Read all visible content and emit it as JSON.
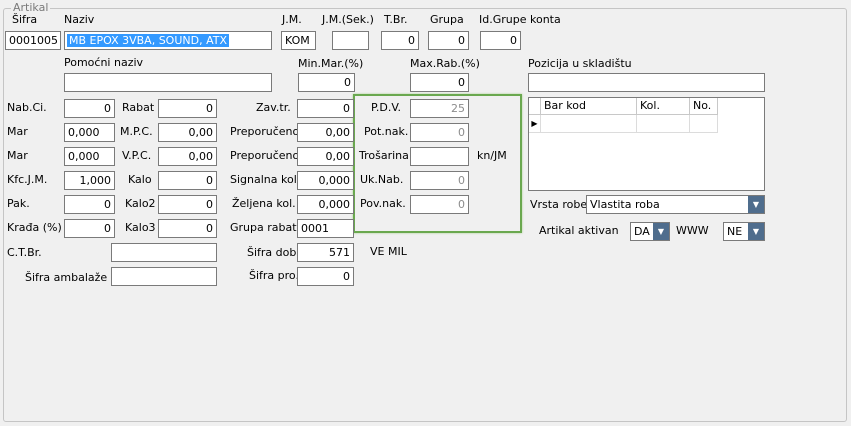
{
  "group_title": "Artikal",
  "labels": {
    "sifra": "Šifra",
    "naziv": "Naziv",
    "jm": "J.M.",
    "jm_sek": "J.M.(Sek.)",
    "tbr": "T.Br.",
    "grupa": "Grupa",
    "id_grupe": "Id.Grupe konta",
    "pomocni": "Pomoćni naziv",
    "min_mar": "Min.Mar.(%)",
    "max_rab": "Max.Rab.(%)",
    "pozicija": "Pozicija u skladištu",
    "nab_ci": "Nab.Ci.",
    "rabat": "Rabat",
    "zav_tr": "Zav.tr.",
    "mar1": "Mar",
    "mpc": "M.P.C.",
    "preporuceno1": "Preporučeno",
    "mar2": "Mar",
    "vpc": "V.P.C.",
    "preporuceno2": "Preporučeno",
    "kfc_jm": "Kfc.J.M.",
    "kalo": "Kalo",
    "signalna": "Signalna kol.",
    "pak": "Pak.",
    "kalo2": "Kalo2",
    "zeljena": "Željena kol.",
    "krada": "Krađa (%)",
    "kalo3": "Kalo3",
    "grupa_rabata": "Grupa rabata",
    "ctbr": "C.T.Br.",
    "sifra_dob": "Šifra dob.",
    "ve_mil": "VE MIL",
    "sifra_amb": "Šifra ambalaže",
    "sifra_pro": "Šifra pro.",
    "pdv": "P.D.V.",
    "pot_nak": "Pot.nak.",
    "trosarina": "Trošarina",
    "kn_jm": "kn/JM",
    "uk_nab": "Uk.Nab.",
    "pov_nak": "Pov.nak.",
    "vrsta_robe": "Vrsta robe",
    "artikal_aktivan": "Artikal aktivan",
    "www": "WWW"
  },
  "values": {
    "sifra": "0001005",
    "naziv": "MB EPOX 3VBA, SOUND, ATX",
    "jm": "KOM",
    "jm_sek": "",
    "tbr": "0",
    "grupa": "0",
    "id_grupe": "0",
    "pomocni": "",
    "min_mar": "0",
    "max_rab": "0",
    "pozicija": "",
    "nab_ci": "0",
    "rabat": "0",
    "zav_tr": "0",
    "mar1": "0,000",
    "mpc": "0,00",
    "preporuceno1": "0,00",
    "mar2": "0,000",
    "vpc": "0,00",
    "preporuceno2": "0,00",
    "kfc_jm": "1,000",
    "kalo": "0",
    "signalna": "0,000",
    "pak": "0",
    "kalo2": "0",
    "zeljena": "0,000",
    "krada": "0",
    "kalo3": "0",
    "grupa_rabata": "0001",
    "ctbr": "",
    "sifra_dob": "571",
    "sifra_amb": "",
    "sifra_pro": "0",
    "pdv": "25",
    "pot_nak": "0",
    "trosarina": "",
    "uk_nab": "0",
    "pov_nak": "0",
    "vrsta_robe": "Vlastita roba",
    "artikal_aktivan": "DA",
    "www": "NE"
  },
  "grid": {
    "columns": [
      "Bar kod",
      "Kol.",
      "No."
    ],
    "row_marker": "▶"
  },
  "icons": {
    "dropdown": "chevron-down-icon",
    "row_pointer": "row-pointer-icon"
  },
  "colors": {
    "highlight_border": "#6aa84f",
    "selection": "#3399ff",
    "combo_button": "#4f6d8d"
  }
}
